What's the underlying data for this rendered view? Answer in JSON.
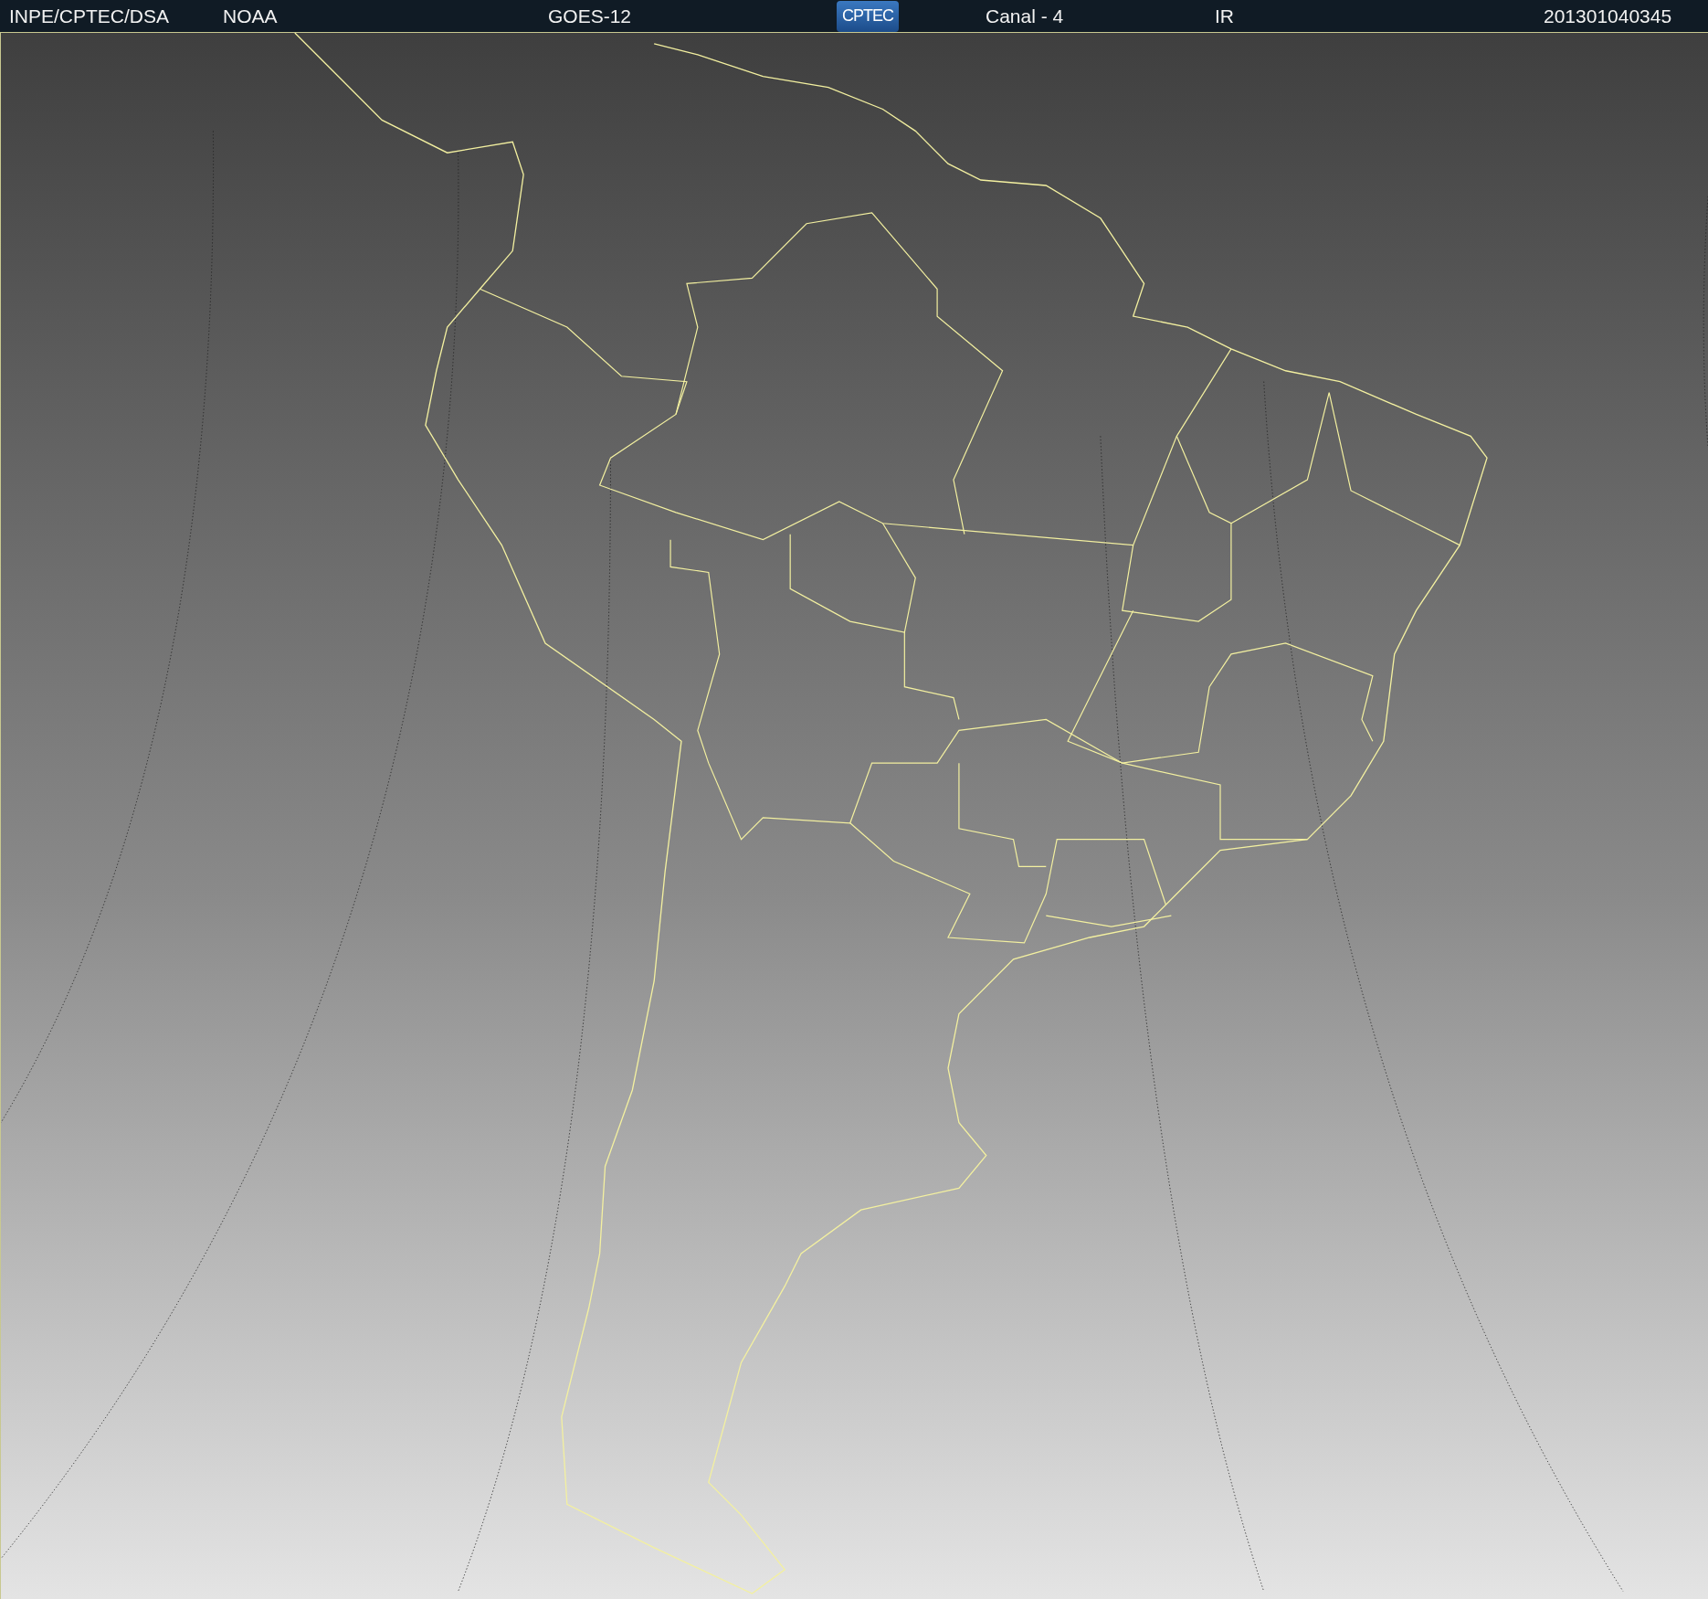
{
  "header": {
    "items": [
      {
        "kind": "label",
        "text": "INPE/CPTEC/DSA"
      },
      {
        "kind": "label",
        "text": "NOAA"
      },
      {
        "kind": "label",
        "text": "GOES-12"
      },
      {
        "kind": "logo",
        "text": "CPTEC"
      },
      {
        "kind": "label",
        "text": "Canal - 4"
      },
      {
        "kind": "label",
        "text": "IR"
      },
      {
        "kind": "label",
        "text": "201301040345"
      }
    ]
  }
}
